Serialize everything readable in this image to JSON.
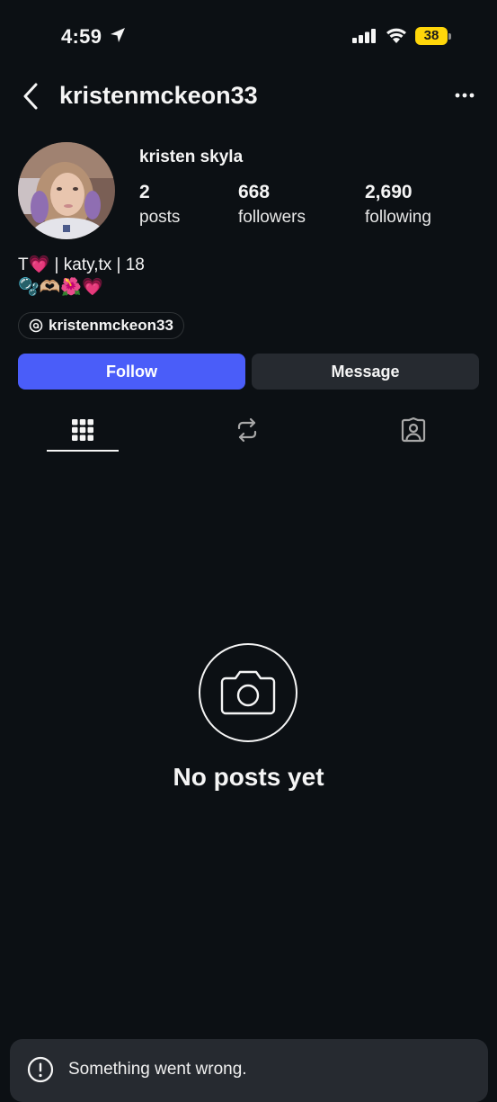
{
  "status_bar": {
    "time": "4:59",
    "battery": "38",
    "battery_color": "#ffd60a"
  },
  "header": {
    "username": "kristenmckeon33"
  },
  "profile": {
    "display_name": "kristen skyla",
    "stats": [
      {
        "value": "2",
        "label": "posts"
      },
      {
        "value": "668",
        "label": "followers"
      },
      {
        "value": "2,690",
        "label": "following"
      }
    ],
    "bio_line1": "T💗  |  katy,tx | 18",
    "bio_line2": "🫧🫶🏼🌺💗",
    "threads_handle": "kristenmckeon33"
  },
  "actions": {
    "follow_label": "Follow",
    "message_label": "Message",
    "follow_color": "#4a5df9"
  },
  "tabs": [
    {
      "icon": "grid-icon",
      "selected": true
    },
    {
      "icon": "reposts-icon",
      "selected": false
    },
    {
      "icon": "tagged-icon",
      "selected": false
    }
  ],
  "empty_state": {
    "title": "No posts yet",
    "icon": "camera-icon"
  },
  "toast": {
    "message": "Something went wrong.",
    "icon": "alert-icon"
  }
}
